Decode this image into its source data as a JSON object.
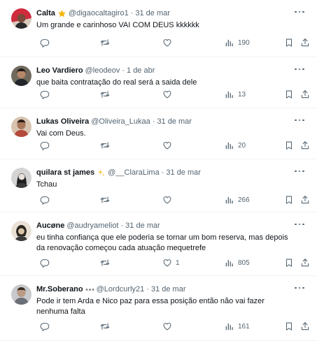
{
  "tweets": [
    {
      "name": "Calta",
      "badge": "star-emoji-icon",
      "handle": "@digaocaltagiro1",
      "dot": "·",
      "time": "31 de mar",
      "text": "Um grande e carinhoso VAI COM DEUS kkkkkk",
      "likes": "",
      "views": "190"
    },
    {
      "name": "Leo Vardiero",
      "badge": "",
      "handle": "@leodeov",
      "dot": "·",
      "time": "1 de abr",
      "text": "que baita contratação do real será a saida dele",
      "likes": "",
      "views": "13"
    },
    {
      "name": "Lukas Oliveira",
      "badge": "",
      "handle": "@Oliveira_Lukaa",
      "dot": "·",
      "time": "31 de mar",
      "text": "Vai com Deus.",
      "likes": "",
      "views": "20"
    },
    {
      "name": "quilara st james",
      "badge": "sparkle-emoji-icon",
      "handle": "@__ClaraLima",
      "dot": "·",
      "time": "31 de mar",
      "text": "Tchau",
      "likes": "",
      "views": "266"
    },
    {
      "name": "Aucøne",
      "badge": "",
      "handle": "@audryameliot",
      "dot": "·",
      "time": "31 de mar",
      "text": "eu tinha confiança que ele poderia se tornar um bom reserva, mas depois da renovação começou cada atuação mequetrefe",
      "likes": "1",
      "views": "805"
    },
    {
      "name": "Mr.Soberano",
      "badge": "club-crest-emoji-icon",
      "handle": "@Lordcurly21",
      "dot": "·",
      "time": "31 de mar",
      "text": "Pode ir tem Arda e Nico paz para essa posição então não vai fazer nenhuma falta",
      "likes": "",
      "views": "161"
    }
  ],
  "colors": {
    "text": "#0f1419",
    "muted": "#536471",
    "divider": "#eff3f4"
  }
}
